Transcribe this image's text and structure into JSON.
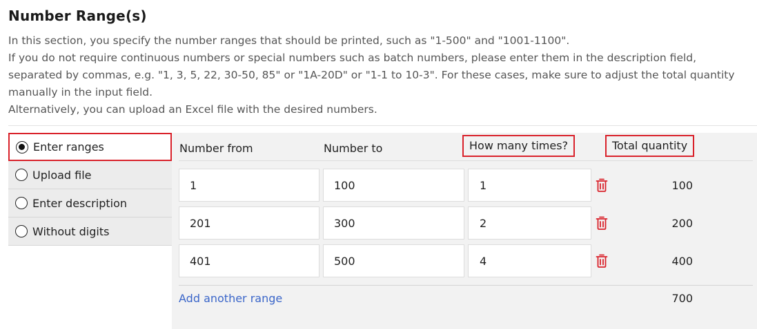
{
  "section": {
    "title": "Number Range(s)",
    "description": [
      "In this section, you specify the number ranges that should be printed, such as \"1-500\" and \"1001-1100\".",
      "If you do not require continuous numbers or special numbers such as batch numbers, please enter them in the description field, separated by commas, e.g. \"1, 3, 5, 22, 30-50, 85\" or \"1A-20D\" or \"1-1 to 10-3\". For these cases, make sure to adjust the total quantity manually in the input field.",
      "Alternatively, you can upload an Excel file with the desired numbers."
    ]
  },
  "options": [
    {
      "label": "Enter ranges",
      "selected": true
    },
    {
      "label": "Upload file",
      "selected": false
    },
    {
      "label": "Enter description",
      "selected": false
    },
    {
      "label": "Without digits",
      "selected": false
    }
  ],
  "table": {
    "headers": {
      "from": "Number from",
      "to": "Number to",
      "times": "How many times?",
      "total": "Total quantity"
    },
    "rows": [
      {
        "from": "1",
        "to": "100",
        "times": "1",
        "total": "100"
      },
      {
        "from": "201",
        "to": "300",
        "times": "2",
        "total": "200"
      },
      {
        "from": "401",
        "to": "500",
        "times": "4",
        "total": "400"
      }
    ],
    "add_label": "Add another range",
    "grand_total": "700"
  },
  "icons": {
    "delete": "trash-icon"
  },
  "colors": {
    "highlight": "#d9212a",
    "link": "#3b66c9",
    "trash": "#d9212a",
    "panel": "#f2f2f2"
  }
}
